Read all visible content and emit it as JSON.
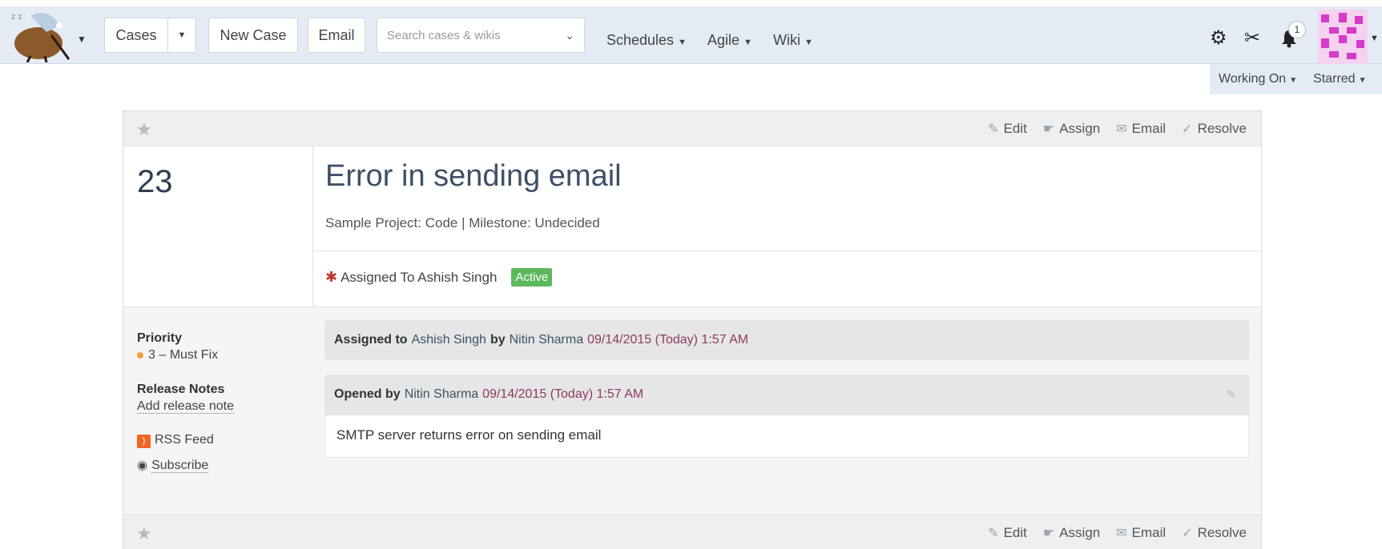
{
  "topbar": {
    "cases_label": "Cases",
    "new_case_label": "New Case",
    "email_label": "Email",
    "search_placeholder": "Search cases & wikis",
    "nav": [
      {
        "label": "Schedules"
      },
      {
        "label": "Agile"
      },
      {
        "label": "Wiki"
      }
    ],
    "notification_count": "1"
  },
  "subnav": {
    "working_on": "Working On",
    "starred": "Starred"
  },
  "case": {
    "number": "23",
    "title": "Error in sending email",
    "project_line": "Sample Project: Code | Milestone: Undecided",
    "assigned_text": "Assigned To Ashish Singh",
    "status": "Active",
    "actions": {
      "edit": "Edit",
      "assign": "Assign",
      "email": "Email",
      "resolve": "Resolve"
    }
  },
  "sidebar": {
    "priority_label": "Priority",
    "priority_value": "3 – Must Fix",
    "release_notes_label": "Release Notes",
    "add_release_note": "Add release note",
    "rss_feed": "RSS Feed",
    "subscribe": "Subscribe"
  },
  "events": [
    {
      "prefix": "Assigned to",
      "target": "Ashish Singh",
      "by": "by",
      "author": "Nitin Sharma",
      "date": "09/14/2015 (Today) 1:57 AM"
    },
    {
      "prefix": "Opened by",
      "author": "Nitin Sharma",
      "date": "09/14/2015 (Today) 1:57 AM",
      "body": "SMTP server returns error on sending email"
    }
  ],
  "colors": {
    "topbar_bg": "#e4ebf4",
    "status_active": "#5cb85c",
    "date_color": "#8e3b63",
    "person_color": "#3e5066"
  }
}
